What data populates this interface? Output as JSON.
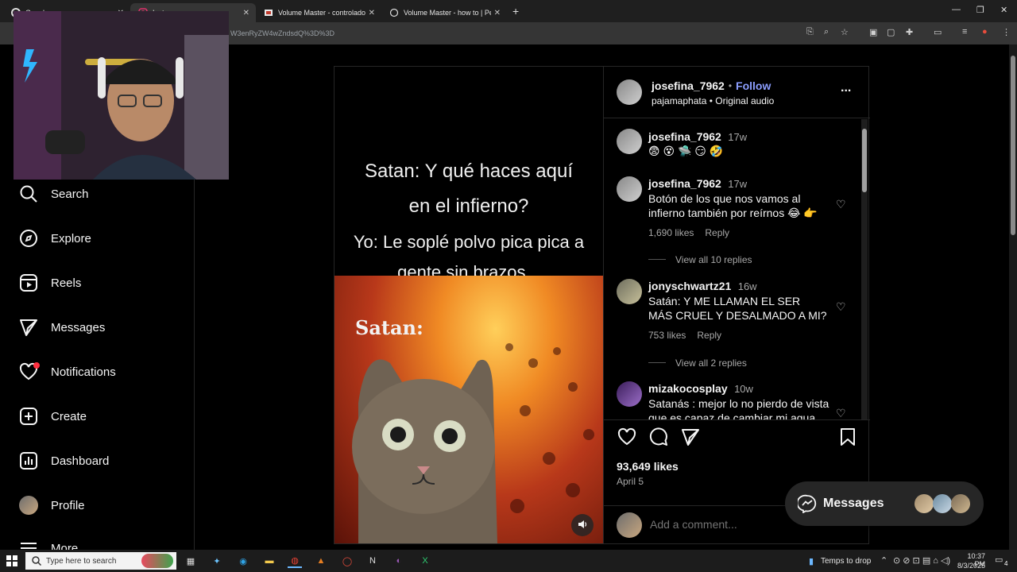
{
  "browser": {
    "tabs": [
      {
        "label": "Google",
        "icon": "google-icon"
      },
      {
        "label": "Instagram",
        "icon": "instagram-icon"
      },
      {
        "label": "Volume Master - controlador d",
        "icon": "volume-icon"
      },
      {
        "label": "Volume Master - how to | Peta",
        "icon": "globe-icon"
      }
    ],
    "new_tab": "+",
    "url": "W3enRyZW4wZndsdQ%3D%3D",
    "win_minimize": "—",
    "win_restore": "❐",
    "win_close": "✕"
  },
  "sidebar": {
    "items": [
      {
        "label": "Search",
        "icon": "search-icon"
      },
      {
        "label": "Explore",
        "icon": "compass-icon"
      },
      {
        "label": "Reels",
        "icon": "reels-icon"
      },
      {
        "label": "Messages",
        "icon": "send-icon"
      },
      {
        "label": "Notifications",
        "icon": "heart-icon"
      },
      {
        "label": "Create",
        "icon": "plus-square-icon"
      },
      {
        "label": "Dashboard",
        "icon": "dashboard-icon"
      },
      {
        "label": "Profile",
        "icon": "avatar"
      },
      {
        "label": "More",
        "icon": "menu-icon"
      }
    ]
  },
  "post": {
    "media": {
      "caption_lines": [
        "Satan: Y qué haces aquí",
        "en el infierno?",
        "Yo: Le soplé polvo pica pica a",
        "gente sin brazos..."
      ],
      "image_label": "Satan:"
    },
    "header": {
      "username": "josefina_7962",
      "separator": "•",
      "follow": "Follow",
      "audio": "pajamaphata • Original audio",
      "more": "..."
    },
    "comments": [
      {
        "user": "josefina_7962",
        "time": "17w",
        "text": "😨 😵 🛸 😏 🤣",
        "likes": "",
        "reply": "",
        "view_replies": ""
      },
      {
        "user": "josefina_7962",
        "time": "17w",
        "text": "Botón de los que nos vamos al infierno también por reírnos 😂 👉",
        "likes": "1,690 likes",
        "reply": "Reply",
        "view_replies": "View all 10 replies"
      },
      {
        "user": "jonyschwartz21",
        "time": "16w",
        "text": "Satán: Y ME LLAMAN EL SER MÁS CRUEL Y DESALMADO A MI?",
        "likes": "753 likes",
        "reply": "Reply",
        "view_replies": "View all 2 replies"
      },
      {
        "user": "mizakocosplay",
        "time": "10w",
        "text": "Satanás : mejor lo no pierdo de vista que es capaz de cambiar mi agua",
        "likes": "",
        "reply": "",
        "view_replies": ""
      }
    ],
    "likes": "93,649 likes",
    "date": "April 5",
    "add_comment_placeholder": "Add a comment..."
  },
  "messages_pill": {
    "label": "Messages"
  },
  "taskbar": {
    "search_placeholder": "Type here to search",
    "weather": "Temps to drop",
    "time": "10:37 PM",
    "date": "8/3/2025",
    "notif_count": "4"
  },
  "colors": {
    "follow": "#8c9eff",
    "notif_dot": "#ff3040",
    "bg": "#000000"
  }
}
